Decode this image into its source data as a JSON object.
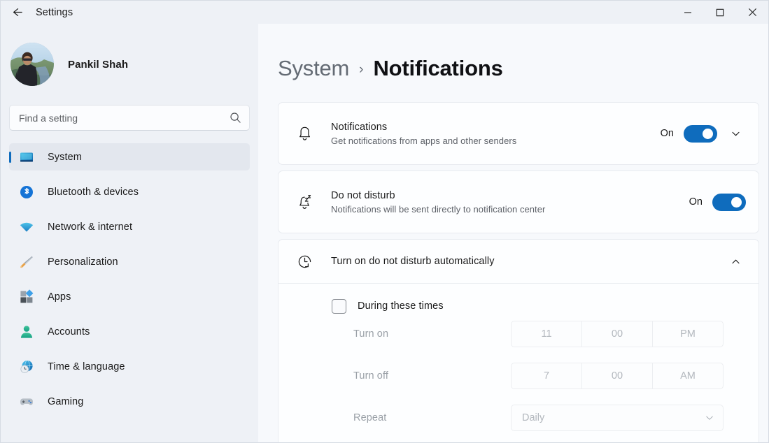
{
  "window": {
    "title": "Settings",
    "back_icon": "back-arrow-icon",
    "minimize_label": "Minimize",
    "maximize_label": "Maximize",
    "close_label": "Close"
  },
  "sidebar": {
    "profile": {
      "name": "Pankil Shah"
    },
    "search": {
      "placeholder": "Find a setting",
      "value": ""
    },
    "items": [
      {
        "label": "System",
        "icon": "monitor-icon",
        "active": true
      },
      {
        "label": "Bluetooth & devices",
        "icon": "bluetooth-icon",
        "active": false
      },
      {
        "label": "Network & internet",
        "icon": "wifi-icon",
        "active": false
      },
      {
        "label": "Personalization",
        "icon": "paintbrush-icon",
        "active": false
      },
      {
        "label": "Apps",
        "icon": "apps-icon",
        "active": false
      },
      {
        "label": "Accounts",
        "icon": "person-icon",
        "active": false
      },
      {
        "label": "Time & language",
        "icon": "globe-clock-icon",
        "active": false
      },
      {
        "label": "Gaming",
        "icon": "gamepad-icon",
        "active": false
      }
    ]
  },
  "breadcrumb": {
    "parent": "System",
    "separator": "›",
    "current": "Notifications"
  },
  "cards": {
    "notifications": {
      "icon": "bell-icon",
      "title": "Notifications",
      "subtitle": "Get notifications from apps and other senders",
      "toggle_state": "On",
      "expand_icon": "chevron-down-icon"
    },
    "do_not_disturb": {
      "icon": "bell-sleep-icon",
      "title": "Do not disturb",
      "subtitle": "Notifications will be sent directly to notification center",
      "toggle_state": "On"
    },
    "auto_dnd": {
      "icon": "clock-icon",
      "title": "Turn on do not disturb automatically",
      "collapse_icon": "chevron-up-icon",
      "checkbox": {
        "label": "During these times",
        "checked": false
      },
      "turn_on": {
        "label": "Turn on",
        "hour": "11",
        "minute": "00",
        "meridiem": "PM"
      },
      "turn_off": {
        "label": "Turn off",
        "hour": "7",
        "minute": "00",
        "meridiem": "AM"
      },
      "repeat": {
        "label": "Repeat",
        "value": "Daily",
        "chevron_icon": "chevron-down-icon"
      }
    }
  },
  "colors": {
    "accent": "#0f6cbd",
    "sidebar_bg": "#eef1f6",
    "content_bg": "#f7f9fc",
    "card_bg": "#fdfeff"
  }
}
